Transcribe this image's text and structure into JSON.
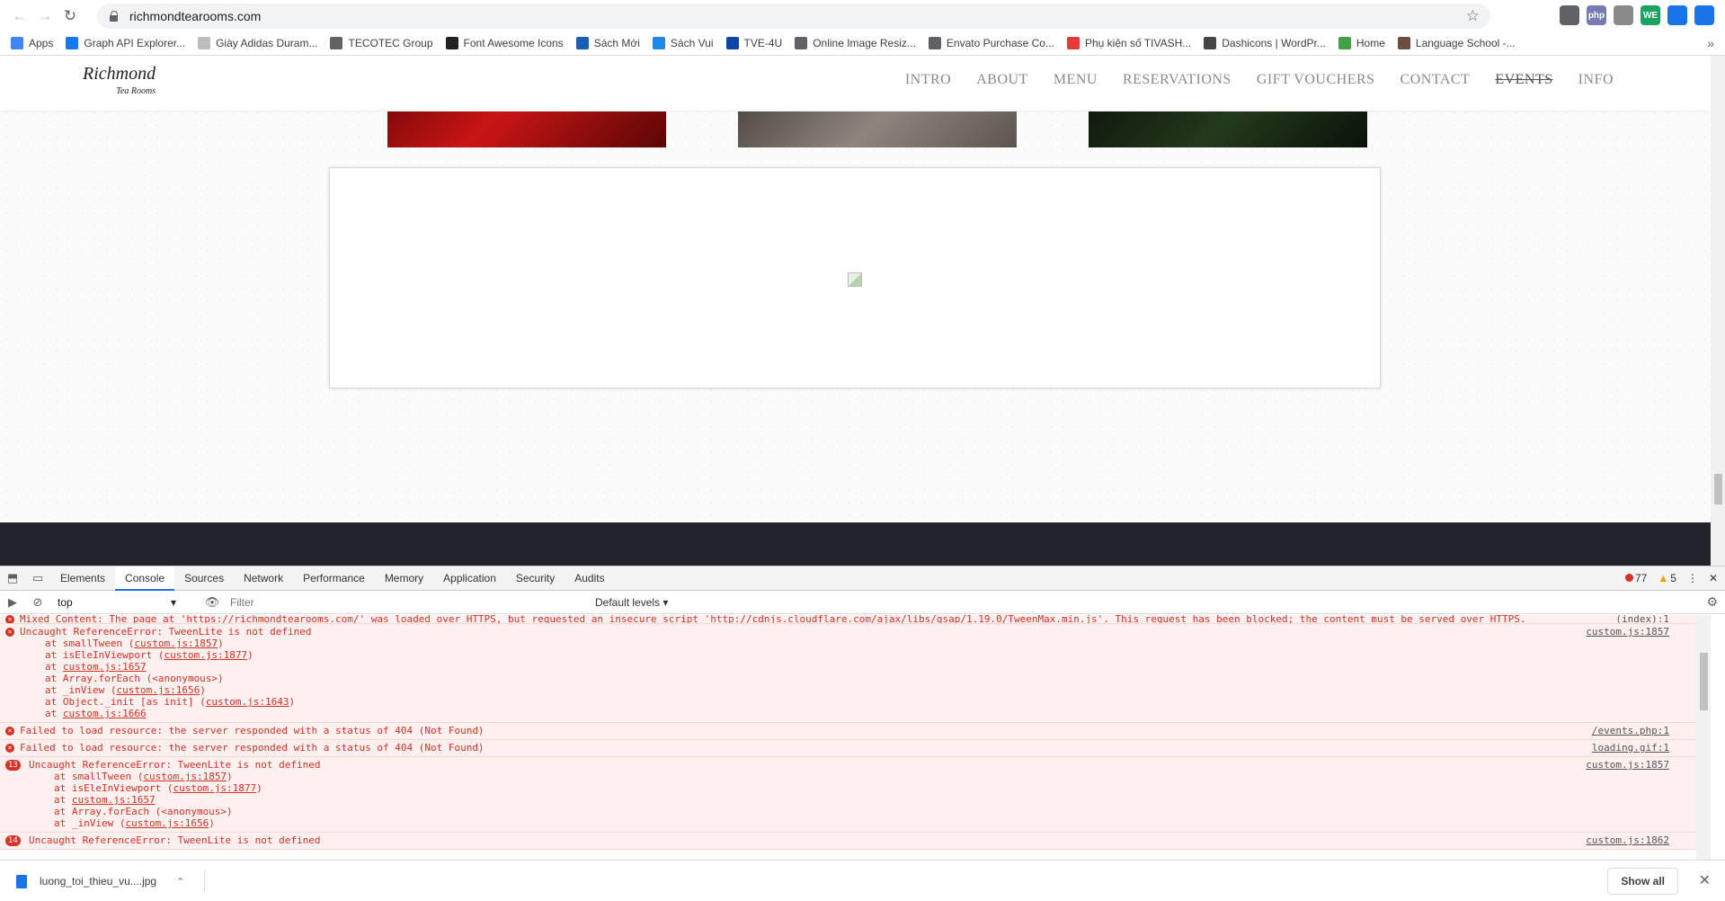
{
  "browser": {
    "url": "richmondtearooms.com",
    "bookmarks": [
      {
        "label": "Apps",
        "color": "#4285f4"
      },
      {
        "label": "Graph API Explorer...",
        "color": "#1877f2"
      },
      {
        "label": "Giày Adidas Duram...",
        "color": "#bdbdbd"
      },
      {
        "label": "TECOTEC Group",
        "color": "#5f6368"
      },
      {
        "label": "Font Awesome Icons",
        "color": "#222222"
      },
      {
        "label": "Sách Mới",
        "color": "#1a5fb4"
      },
      {
        "label": "Sách Vui",
        "color": "#1e88e5"
      },
      {
        "label": "TVE-4U",
        "color": "#0d47a1"
      },
      {
        "label": "Online Image Resiz...",
        "color": "#5f6368"
      },
      {
        "label": "Envato Purchase Co...",
        "color": "#5f6368"
      },
      {
        "label": "Phụ kiện số TIVASH...",
        "color": "#e53935"
      },
      {
        "label": "Dashicons | WordPr...",
        "color": "#464646"
      },
      {
        "label": "Home",
        "color": "#43a047"
      },
      {
        "label": "Language School -...",
        "color": "#6d4c41"
      }
    ],
    "extensions": [
      {
        "label": "",
        "color": "#5f6368"
      },
      {
        "label": "php",
        "color": "#777bb3"
      },
      {
        "label": "",
        "color": "#8a8a8a"
      },
      {
        "label": "WE",
        "color": "#1aa260"
      },
      {
        "label": "",
        "color": "#1a73e8"
      },
      {
        "label": "",
        "color": "#1a73e8"
      }
    ]
  },
  "site": {
    "logo_main": "Richmond",
    "logo_sub": "Tea Rooms",
    "nav": [
      "INTRO",
      "ABOUT",
      "MENU",
      "RESERVATIONS",
      "GIFT VOUCHERS",
      "CONTACT",
      "EVENTS",
      "INFO"
    ],
    "struck_nav": "EVENTS"
  },
  "devtools": {
    "tabs": [
      "Elements",
      "Console",
      "Sources",
      "Network",
      "Performance",
      "Memory",
      "Application",
      "Security",
      "Audits"
    ],
    "active_tab": "Console",
    "error_count": "77",
    "warning_count": "5",
    "context": "top",
    "filter_placeholder": "Filter",
    "levels": "Default levels",
    "messages": [
      {
        "type": "cut",
        "text": "Mixed Content: The page at 'https://richmondtearooms.com/' was loaded over HTTPS, but requested an insecure script 'http://cdnjs.cloudflare.com/ajax/libs/gsap/1.19.0/TweenMax.min.js'. This request has been blocked; the content must be served over HTTPS.",
        "src": "(index):1",
        "count": ""
      },
      {
        "type": "error",
        "text": "Uncaught ReferenceError: TweenLite is not defined",
        "src": "custom.js:1857",
        "count": "",
        "stack": [
          {
            "pre": "at smallTween (",
            "link": "custom.js:1857",
            "post": ")"
          },
          {
            "pre": "at isEleInViewport (",
            "link": "custom.js:1877",
            "post": ")"
          },
          {
            "pre": "at ",
            "link": "custom.js:1657",
            "post": ""
          },
          {
            "pre": "at Array.forEach (<anonymous>)",
            "link": "",
            "post": ""
          },
          {
            "pre": "at _inView (",
            "link": "custom.js:1656",
            "post": ")"
          },
          {
            "pre": "at Object._init [as init] (",
            "link": "custom.js:1643",
            "post": ")"
          },
          {
            "pre": "at ",
            "link": "custom.js:1666",
            "post": ""
          }
        ]
      },
      {
        "type": "error",
        "text": "Failed to load resource: the server responded with a status of 404 (Not Found)",
        "src": "/events.php:1",
        "count": "",
        "stack": []
      },
      {
        "type": "error",
        "text": "Failed to load resource: the server responded with a status of 404 (Not Found)",
        "src": "loading.gif:1",
        "count": "",
        "stack": []
      },
      {
        "type": "error",
        "text": "Uncaught ReferenceError: TweenLite is not defined",
        "src": "custom.js:1857",
        "count": "13",
        "stack": [
          {
            "pre": "at smallTween (",
            "link": "custom.js:1857",
            "post": ")"
          },
          {
            "pre": "at isEleInViewport (",
            "link": "custom.js:1877",
            "post": ")"
          },
          {
            "pre": "at ",
            "link": "custom.js:1657",
            "post": ""
          },
          {
            "pre": "at Array.forEach (<anonymous>)",
            "link": "",
            "post": ""
          },
          {
            "pre": "at _inView (",
            "link": "custom.js:1656",
            "post": ")"
          }
        ]
      },
      {
        "type": "error",
        "text": "Uncaught ReferenceError: TweenLite is not defined",
        "src": "custom.js:1862",
        "count": "14",
        "stack": []
      }
    ]
  },
  "download": {
    "filename": "luong_toi_thieu_vu....jpg",
    "show_all": "Show all"
  }
}
